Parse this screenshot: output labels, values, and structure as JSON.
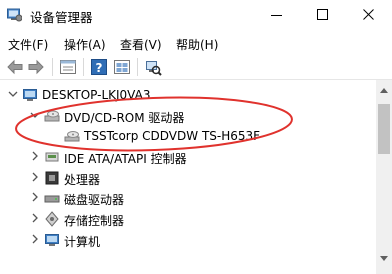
{
  "window": {
    "title": "设备管理器"
  },
  "menu": {
    "items": [
      "文件(F)",
      "操作(A)",
      "查看(V)",
      "帮助(H)"
    ]
  },
  "toolbar": {
    "icons": [
      "back-arrow-icon",
      "forward-arrow-icon",
      "properties-grid-icon",
      "help-icon",
      "view-grid-icon",
      "scan-hardware-icon"
    ]
  },
  "tree": {
    "root": "DESKTOP-LKJ0VA3",
    "items": [
      {
        "label": "DVD/CD-ROM 驱动器",
        "expanded": true,
        "icon": "dvd-drive-icon"
      },
      {
        "label": "TSSTcorp CDDVDW TS-H653F",
        "icon": "disc-device-icon"
      },
      {
        "label": "IDE ATA/ATAPI 控制器",
        "icon": "ide-controller-icon"
      },
      {
        "label": "处理器",
        "icon": "processor-icon"
      },
      {
        "label": "磁盘驱动器",
        "icon": "disk-drive-icon"
      },
      {
        "label": "存储控制器",
        "icon": "storage-controller-icon"
      },
      {
        "label": "计算机",
        "icon": "computer-icon"
      }
    ]
  },
  "colors": {
    "annotation": "#e0322d",
    "accent": "#1a6fc4"
  }
}
